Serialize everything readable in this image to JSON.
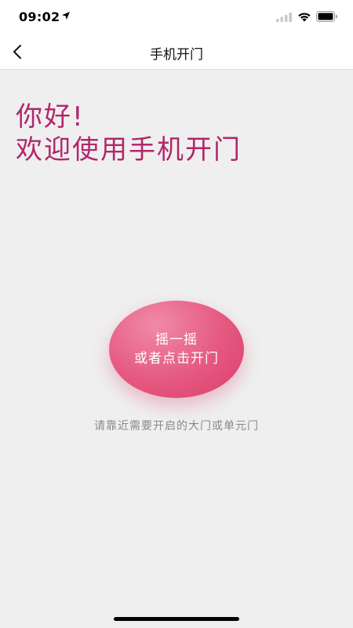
{
  "status_bar": {
    "time": "09:02"
  },
  "nav": {
    "back_icon": "chevron-left-icon",
    "title": "手机开门"
  },
  "greeting": {
    "line1": "你好!",
    "line2": "欢迎使用手机开门"
  },
  "open_button": {
    "line1": "摇一摇",
    "line2": "或者点击开门"
  },
  "hint": "请靠近需要开启的大门或单元门",
  "colors": {
    "accent": "#b3266a",
    "button": "#e5587f",
    "hint": "#8a8a8a",
    "background": "#efefef"
  }
}
